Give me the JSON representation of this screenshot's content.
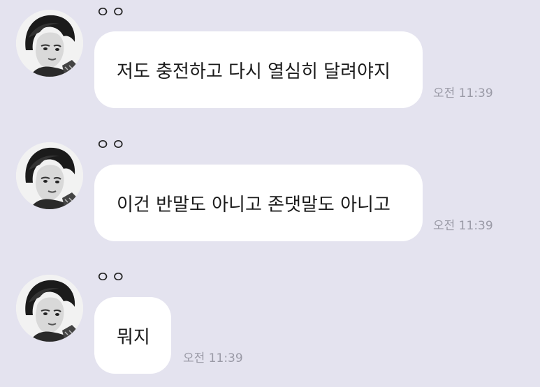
{
  "chat": {
    "messages": [
      {
        "sender": "ㅇㅇ",
        "text": "저도 충전하고 다시 열심히 달려야지",
        "time": "오전 11:39"
      },
      {
        "sender": "ㅇㅇ",
        "text": "이건 반말도 아니고 존댓말도 아니고",
        "time": "오전 11:39"
      },
      {
        "sender": "ㅇㅇ",
        "text": "뭐지",
        "time": "오전 11:39"
      }
    ]
  },
  "colors": {
    "background": "#e4e3ef",
    "bubble": "#ffffff",
    "timestamp": "#9a9aa6"
  },
  "icons": {
    "avatar": "profile-photo"
  }
}
